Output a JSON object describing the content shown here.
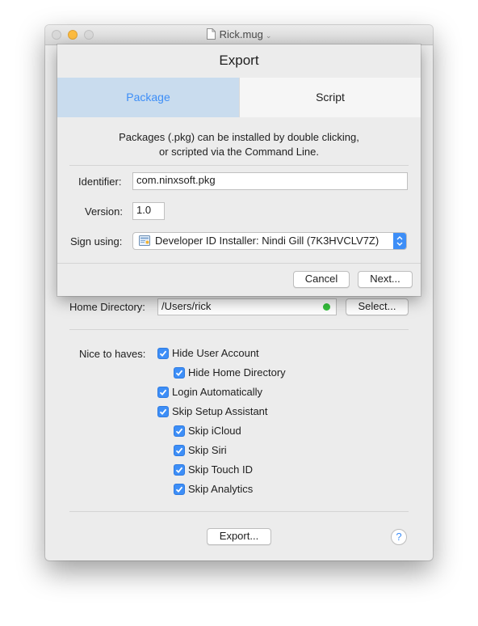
{
  "window": {
    "title": "Rick.mug"
  },
  "sheet": {
    "title": "Export",
    "tabs": [
      {
        "label": "Package",
        "selected": true
      },
      {
        "label": "Script",
        "selected": false
      }
    ],
    "description_line1": "Packages (.pkg) can be installed by double clicking,",
    "description_line2": "or scripted via the Command Line.",
    "identifier_label": "Identifier:",
    "identifier_value": "com.ninxsoft.pkg",
    "version_label": "Version:",
    "version_value": "1.0",
    "sign_label": "Sign using:",
    "sign_value": "Developer ID Installer: Nindi Gill (7K3HVCLV7Z)",
    "cancel_label": "Cancel",
    "next_label": "Next..."
  },
  "main": {
    "home_dir_label": "Home Directory:",
    "home_dir_value": "/Users/rick",
    "select_label": "Select...",
    "nice_label": "Nice to haves:",
    "options": [
      {
        "label": "Hide User Account",
        "checked": true
      },
      {
        "label": "Hide Home Directory",
        "checked": true
      },
      {
        "label": "Login Automatically",
        "checked": true
      },
      {
        "label": "Skip Setup Assistant",
        "checked": true
      },
      {
        "label": "Skip iCloud",
        "checked": true
      },
      {
        "label": "Skip Siri",
        "checked": true
      },
      {
        "label": "Skip Touch ID",
        "checked": true
      },
      {
        "label": "Skip Analytics",
        "checked": true
      }
    ],
    "export_label": "Export...",
    "help_label": "?"
  },
  "colors": {
    "accent": "#3d8ef7",
    "tab_selected_bg": "#c9dcee",
    "status_ok": "#35c23c",
    "minimize": "#fdbc40"
  },
  "icons": [
    "document-icon",
    "chevron-down-icon",
    "certificate-icon",
    "checkmark-icon",
    "help-icon"
  ]
}
